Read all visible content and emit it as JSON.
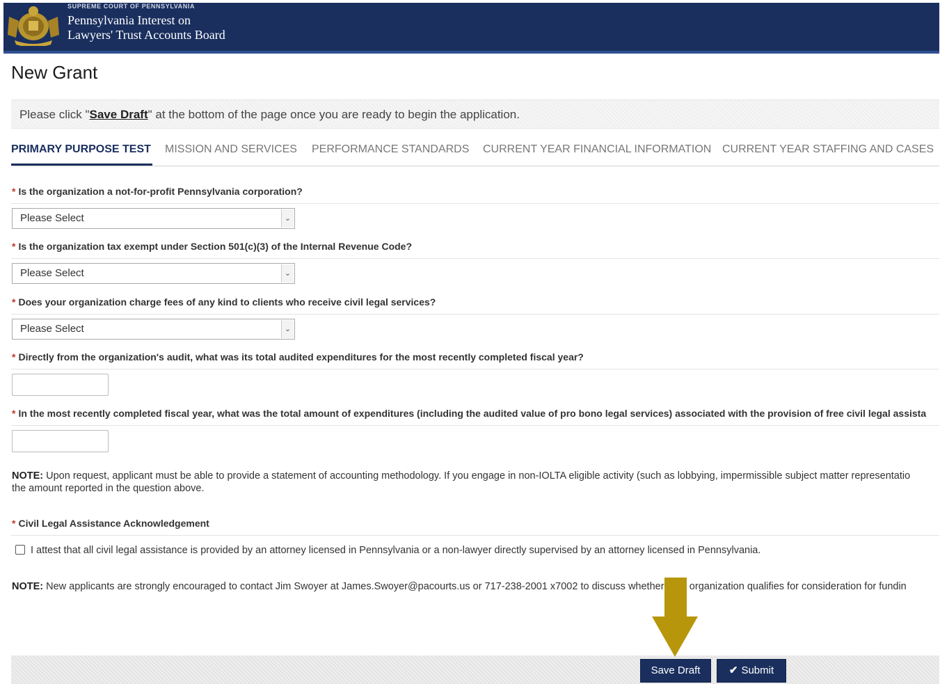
{
  "header": {
    "court": "SUPREME COURT OF PENNSYLVANIA",
    "board_line1": "Pennsylvania Interest on",
    "board_line2": "Lawyers' Trust Accounts Board",
    "logo_icon": "pennsylvania-seal-icon"
  },
  "page": {
    "title": "New Grant"
  },
  "notice": {
    "before": "Please click \"",
    "link": "Save Draft",
    "after": "\" at the bottom of the page once you are ready to begin the application."
  },
  "tabs": [
    {
      "label": "PRIMARY PURPOSE TEST",
      "active": true
    },
    {
      "label": "MISSION AND SERVICES",
      "active": false
    },
    {
      "label": "PERFORMANCE STANDARDS",
      "active": false
    },
    {
      "label": "CURRENT YEAR FINANCIAL INFORMATION",
      "active": false
    },
    {
      "label": "CURRENT YEAR STAFFING AND CASES",
      "active": false
    }
  ],
  "questions": {
    "required_marker": "*",
    "q1": "Is the organization a not-for-profit Pennsylvania corporation?",
    "q2": "Is the organization tax exempt under Section 501(c)(3) of the Internal Revenue Code?",
    "q3": "Does your organization charge fees of any kind to clients who receive civil legal services?",
    "q4": "Directly from the organization's audit, what was its total audited expenditures for the most recently completed fiscal year?",
    "q5": "In the most recently completed fiscal year, what was the total amount of expenditures (including the audited value of pro bono legal services) associated with the provision of free civil legal assista",
    "q6": "Civil Legal Assistance Acknowledgement"
  },
  "selects": {
    "s1": "Please Select",
    "s2": "Please Select",
    "s3": "Please Select",
    "arrow_icon": "chevron-down-icon"
  },
  "inputs": {
    "q4_value": "",
    "q5_value": ""
  },
  "notes": {
    "label": "NOTE:",
    "note1_line1": " Upon request, applicant must be able to provide a statement of accounting methodology. If you engage in non-IOLTA eligible activity (such as lobbying, impermissible subject matter representatio",
    "note1_line2": "the amount reported in the question above.",
    "note2": " New applicants are strongly encouraged to contact Jim Swoyer at James.Swoyer@pacourts.us or 717-238-2001 x7002 to discuss whether your organization qualifies for consideration for fundin"
  },
  "attest": {
    "label": "I attest that all civil legal assistance is provided by an attorney licensed in Pennsylvania or a non-lawyer directly supervised by an attorney licensed in Pennsylvania.",
    "checked": false
  },
  "footer": {
    "save_label": "Save Draft",
    "submit_label": "Submit",
    "submit_icon": "checkmark-icon"
  },
  "annotation": {
    "arrow_color": "#b8960c"
  }
}
